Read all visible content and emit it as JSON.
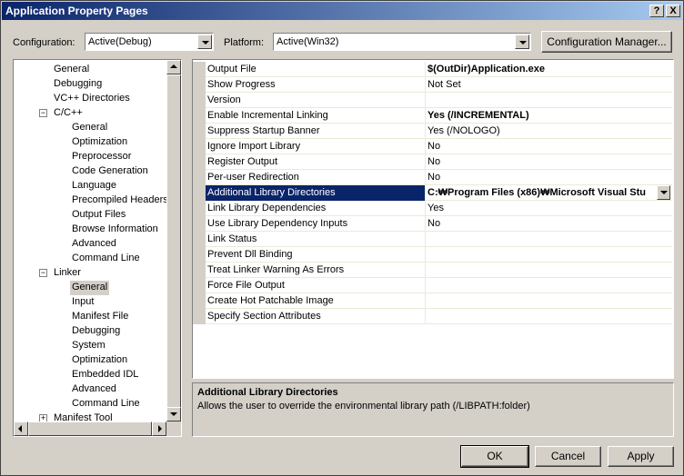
{
  "window": {
    "title": "Application Property Pages",
    "help_button": "?",
    "close_button": "X"
  },
  "config": {
    "configuration_label": "Configuration:",
    "configuration_value": "Active(Debug)",
    "platform_label": "Platform:",
    "platform_value": "Active(Win32)",
    "manager_button": "Configuration Manager..."
  },
  "tree": [
    {
      "label": "General",
      "level": 1
    },
    {
      "label": "Debugging",
      "level": 1
    },
    {
      "label": "VC++ Directories",
      "level": 1
    },
    {
      "label": "C/C++",
      "level": 1,
      "expander": "−"
    },
    {
      "label": "General",
      "level": 2
    },
    {
      "label": "Optimization",
      "level": 2
    },
    {
      "label": "Preprocessor",
      "level": 2
    },
    {
      "label": "Code Generation",
      "level": 2
    },
    {
      "label": "Language",
      "level": 2
    },
    {
      "label": "Precompiled Headers",
      "level": 2
    },
    {
      "label": "Output Files",
      "level": 2
    },
    {
      "label": "Browse Information",
      "level": 2
    },
    {
      "label": "Advanced",
      "level": 2
    },
    {
      "label": "Command Line",
      "level": 2
    },
    {
      "label": "Linker",
      "level": 1,
      "expander": "−"
    },
    {
      "label": "General",
      "level": 2,
      "selected": true
    },
    {
      "label": "Input",
      "level": 2
    },
    {
      "label": "Manifest File",
      "level": 2
    },
    {
      "label": "Debugging",
      "level": 2
    },
    {
      "label": "System",
      "level": 2
    },
    {
      "label": "Optimization",
      "level": 2
    },
    {
      "label": "Embedded IDL",
      "level": 2
    },
    {
      "label": "Advanced",
      "level": 2
    },
    {
      "label": "Command Line",
      "level": 2
    },
    {
      "label": "Manifest Tool",
      "level": 1,
      "expander": "+"
    }
  ],
  "properties": [
    {
      "name": "Output File",
      "value": "$(OutDir)Application.exe",
      "bold": true
    },
    {
      "name": "Show Progress",
      "value": "Not Set"
    },
    {
      "name": "Version",
      "value": ""
    },
    {
      "name": "Enable Incremental Linking",
      "value": "Yes (/INCREMENTAL)",
      "bold": true
    },
    {
      "name": "Suppress Startup Banner",
      "value": "Yes (/NOLOGO)"
    },
    {
      "name": "Ignore Import Library",
      "value": "No"
    },
    {
      "name": "Register Output",
      "value": "No"
    },
    {
      "name": "Per-user Redirection",
      "value": "No"
    },
    {
      "name": "Additional Library Directories",
      "value": "C:₩Program Files (x86)₩Microsoft Visual Stu",
      "bold": true,
      "selected": true,
      "dropdown": true
    },
    {
      "name": "Link Library Dependencies",
      "value": "Yes"
    },
    {
      "name": "Use Library Dependency Inputs",
      "value": "No"
    },
    {
      "name": "Link Status",
      "value": ""
    },
    {
      "name": "Prevent Dll Binding",
      "value": ""
    },
    {
      "name": "Treat Linker Warning As Errors",
      "value": ""
    },
    {
      "name": "Force File Output",
      "value": ""
    },
    {
      "name": "Create Hot Patchable Image",
      "value": ""
    },
    {
      "name": "Specify Section Attributes",
      "value": ""
    }
  ],
  "description": {
    "title": "Additional Library Directories",
    "text": "Allows the user to override the environmental library path (/LIBPATH:folder)"
  },
  "buttons": {
    "ok": "OK",
    "cancel": "Cancel",
    "apply": "Apply"
  },
  "colors": {
    "selection": "#0a246a",
    "face": "#d4d0c8"
  }
}
